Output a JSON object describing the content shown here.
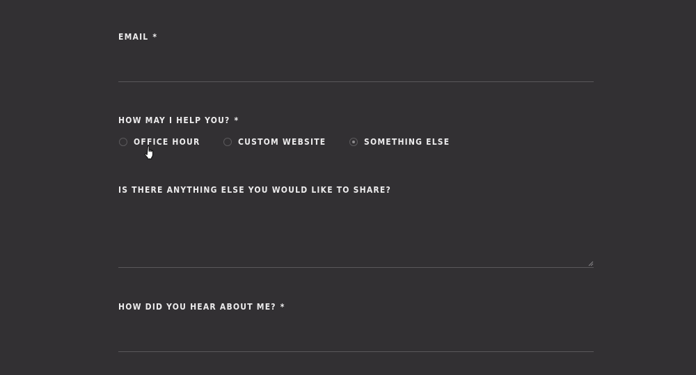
{
  "form": {
    "email": {
      "label": "EMAIL",
      "required_mark": "*",
      "value": ""
    },
    "help": {
      "label": "HOW MAY I HELP YOU?",
      "required_mark": "*",
      "options": [
        {
          "label": "OFFICE HOUR",
          "selected": false
        },
        {
          "label": "CUSTOM WEBSITE",
          "selected": false
        },
        {
          "label": "SOMETHING ELSE",
          "selected": true
        }
      ]
    },
    "share": {
      "label": "IS THERE ANYTHING ELSE YOU WOULD LIKE TO SHARE?",
      "value": ""
    },
    "hear": {
      "label": "HOW DID YOU HEAR ABOUT ME?",
      "required_mark": "*",
      "value": ""
    }
  },
  "colors": {
    "background": "#323033",
    "text": "#ecebec",
    "underline": "#5a585b"
  },
  "cursor": {
    "icon": "hand-pointer-icon"
  }
}
